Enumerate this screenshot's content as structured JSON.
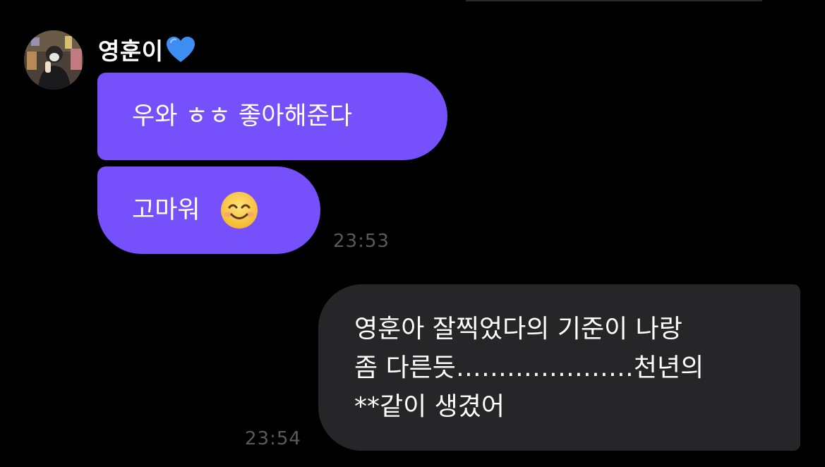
{
  "chat": {
    "sender": {
      "name": "영훈이",
      "heart_emoji": "💙",
      "avatar_icon": "profile-photo"
    },
    "messages": [
      {
        "direction": "incoming",
        "text": "우와 ㅎㅎ 좋아해준다"
      },
      {
        "direction": "incoming",
        "text": "고마워",
        "emoji": "😊",
        "time": "23:53"
      },
      {
        "direction": "outgoing",
        "text": "영훈아 잘찍었다의 기준이 나랑\n좀 다른듯…………………천년의\n**같이 생겼어",
        "time": "23:54"
      }
    ]
  },
  "colors": {
    "background": "#000000",
    "incoming_bubble": "#7650fb",
    "outgoing_bubble": "#262628",
    "timestamp": "#5a5a5e",
    "text": "#ffffff"
  }
}
